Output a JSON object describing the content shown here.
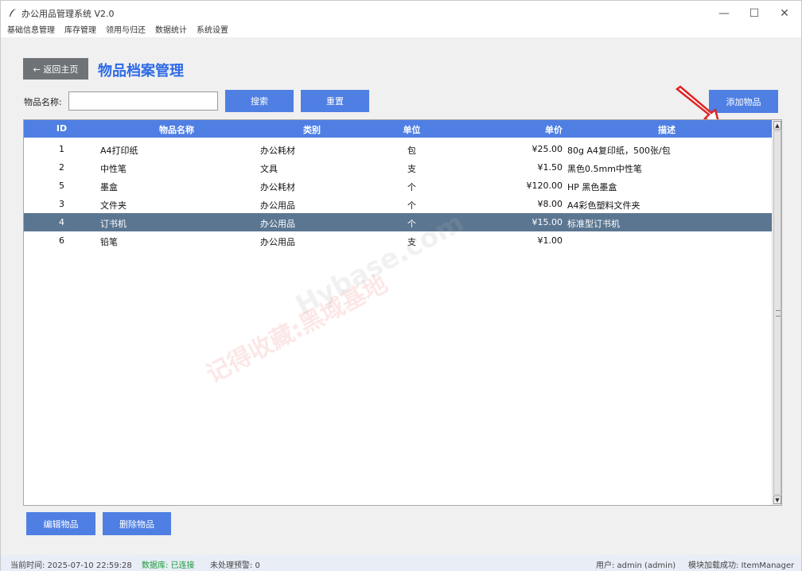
{
  "window": {
    "title": "办公用品管理系统 V2.0",
    "minimize_glyph": "—",
    "maximize_glyph": "☐",
    "close_glyph": "✕"
  },
  "menu": [
    "基础信息管理",
    "库存管理",
    "领用与归还",
    "数据统计",
    "系统设置"
  ],
  "header": {
    "back_label": "← 返回主页",
    "page_title": "物品档案管理"
  },
  "search": {
    "label": "物品名称:",
    "value": "",
    "placeholder": "",
    "search_label": "搜索",
    "reset_label": "重置",
    "add_label": "添加物品"
  },
  "table": {
    "columns": [
      "ID",
      "物品名称",
      "类别",
      "单位",
      "单价",
      "描述"
    ],
    "rows": [
      {
        "id": "1",
        "name": "A4打印纸",
        "category": "办公耗材",
        "unit": "包",
        "price": "¥25.00",
        "desc": "80g A4复印纸，500张/包"
      },
      {
        "id": "2",
        "name": "中性笔",
        "category": "文具",
        "unit": "支",
        "price": "¥1.50",
        "desc": "黑色0.5mm中性笔"
      },
      {
        "id": "5",
        "name": "墨盒",
        "category": "办公耗材",
        "unit": "个",
        "price": "¥120.00",
        "desc": "HP 黑色墨盒"
      },
      {
        "id": "3",
        "name": "文件夹",
        "category": "办公用品",
        "unit": "个",
        "price": "¥8.00",
        "desc": "A4彩色塑料文件夹"
      },
      {
        "id": "4",
        "name": "订书机",
        "category": "办公用品",
        "unit": "个",
        "price": "¥15.00",
        "desc": "标准型订书机"
      },
      {
        "id": "6",
        "name": "铅笔",
        "category": "办公用品",
        "unit": "支",
        "price": "¥1.00",
        "desc": ""
      }
    ],
    "selected_row_index": 4,
    "scroll_up_glyph": "▲",
    "scroll_down_glyph": "▼"
  },
  "actions": {
    "edit_label": "编辑物品",
    "delete_label": "删除物品"
  },
  "watermark": {
    "line1": "记得收藏:黑域基地",
    "line2": "Hybase.com"
  },
  "status": {
    "time": "当前时间: 2025-07-10 22:59:28",
    "db": "数据库: 已连接",
    "alerts": "未处理预警: 0",
    "user": "用户: admin (admin)",
    "module": "模块加载成功: ItemManager"
  },
  "colors": {
    "accent": "#4f7fe3",
    "title_blue": "#2e6be6",
    "selected_row": "#5b7691",
    "arrow_red": "#e02424"
  }
}
